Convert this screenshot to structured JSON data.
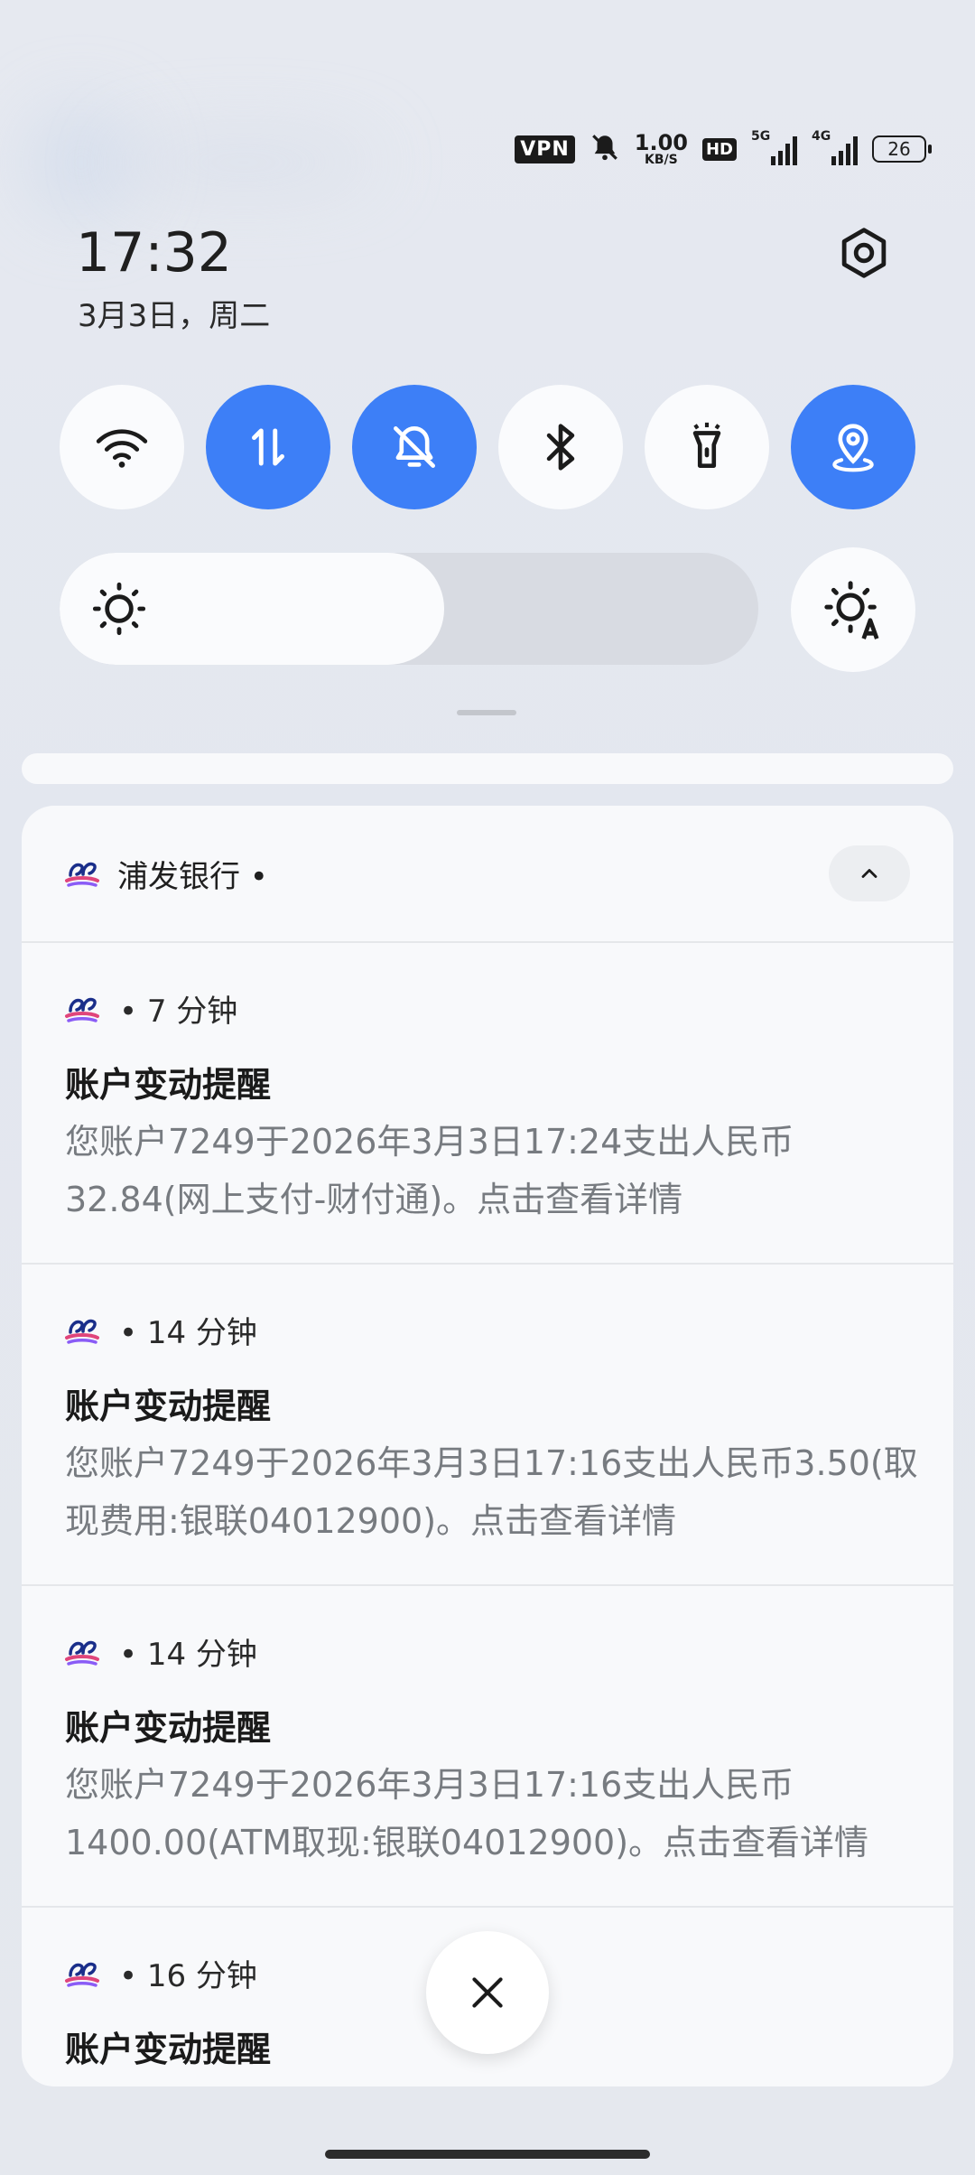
{
  "status_bar": {
    "vpn": "VPN",
    "net_speed_value": "1.00",
    "net_speed_unit": "KB/S",
    "hd": "HD",
    "signal1_label": "5G",
    "signal2_label": "4G",
    "battery": "26"
  },
  "header": {
    "time": "17:32",
    "date": "3月3日，周二"
  },
  "quick_tiles": [
    {
      "name": "wifi",
      "icon": "wifi-icon",
      "active": false
    },
    {
      "name": "mobile-data",
      "icon": "data-arrows-icon",
      "active": true
    },
    {
      "name": "silent",
      "icon": "bell-off-icon",
      "active": true
    },
    {
      "name": "bluetooth",
      "icon": "bluetooth-icon",
      "active": false
    },
    {
      "name": "flashlight",
      "icon": "flashlight-icon",
      "active": false
    },
    {
      "name": "location",
      "icon": "location-icon",
      "active": true
    }
  ],
  "brightness": {
    "level": 0.55
  },
  "notification_group": {
    "app_name": "浦发银行 •",
    "items": [
      {
        "time": "• 7 分钟",
        "title": "账户变动提醒",
        "body": "您账户7249于2026年3月3日17:24支出人民币32.84(网上支付-财付通)。点击查看详情"
      },
      {
        "time": "• 14 分钟",
        "title": "账户变动提醒",
        "body": "您账户7249于2026年3月3日17:16支出人民币3.50(取现费用:银联04012900)。点击查看详情"
      },
      {
        "time": "• 14 分钟",
        "title": "账户变动提醒",
        "body": "您账户7249于2026年3月3日17:16支出人民币1400.00(ATM取现:银联04012900)。点击查看详情"
      },
      {
        "time": "• 16 分钟",
        "title": "账户变动提醒",
        "body": ""
      }
    ]
  },
  "colors": {
    "accent": "#3d7ff7",
    "tile_bg": "#fafbfd",
    "card_bg": "#f8f9fb"
  }
}
